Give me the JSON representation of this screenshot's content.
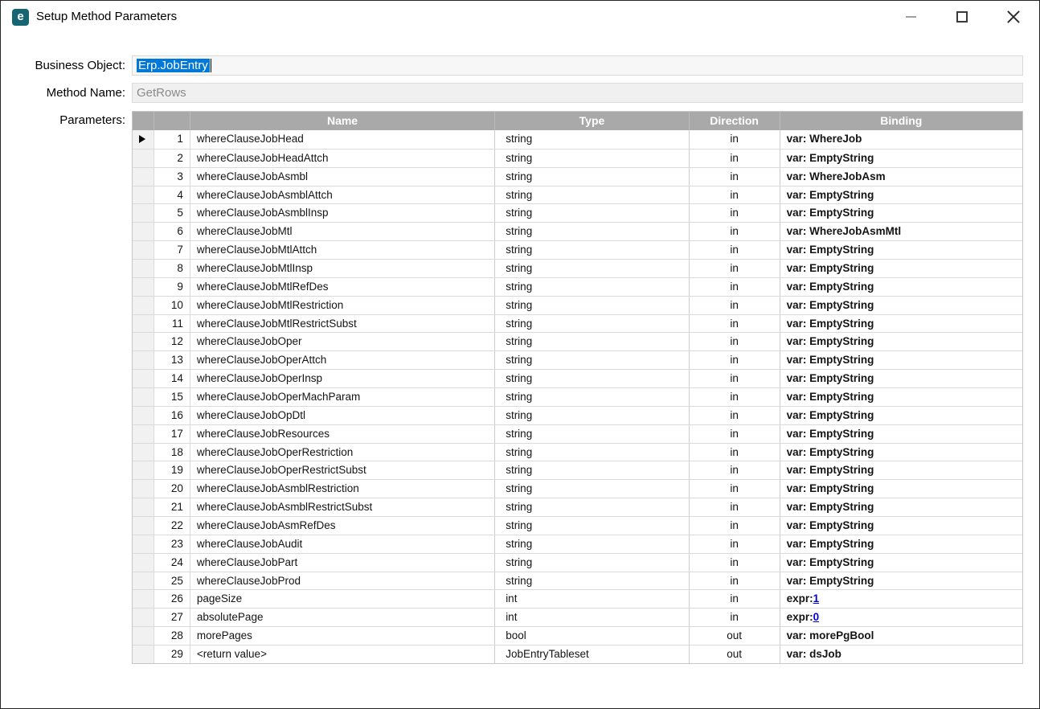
{
  "window": {
    "title": "Setup Method Parameters",
    "app_icon_glyph": "e",
    "controls": [
      {
        "name": "minimize"
      },
      {
        "name": "maximize"
      },
      {
        "name": "close"
      }
    ]
  },
  "form": {
    "business_object": {
      "label": "Business Object:",
      "value": "Erp.JobEntry",
      "selected": true
    },
    "method_name": {
      "label": "Method Name:",
      "value": "GetRows",
      "disabled": true
    },
    "parameters_label": "Parameters:"
  },
  "grid": {
    "columns": [
      "Name",
      "Type",
      "Direction",
      "Binding"
    ],
    "selected_row_index": 0,
    "rows": [
      {
        "num": "1",
        "name": "whereClauseJobHead",
        "type": "string",
        "direction": "in",
        "binding": "var: WhereJob"
      },
      {
        "num": "2",
        "name": "whereClauseJobHeadAttch",
        "type": "string",
        "direction": "in",
        "binding": "var: EmptyString"
      },
      {
        "num": "3",
        "name": "whereClauseJobAsmbl",
        "type": "string",
        "direction": "in",
        "binding": "var: WhereJobAsm"
      },
      {
        "num": "4",
        "name": "whereClauseJobAsmblAttch",
        "type": "string",
        "direction": "in",
        "binding": "var: EmptyString"
      },
      {
        "num": "5",
        "name": "whereClauseJobAsmblInsp",
        "type": "string",
        "direction": "in",
        "binding": "var: EmptyString"
      },
      {
        "num": "6",
        "name": "whereClauseJobMtl",
        "type": "string",
        "direction": "in",
        "binding": "var: WhereJobAsmMtl"
      },
      {
        "num": "7",
        "name": "whereClauseJobMtlAttch",
        "type": "string",
        "direction": "in",
        "binding": "var: EmptyString"
      },
      {
        "num": "8",
        "name": "whereClauseJobMtlInsp",
        "type": "string",
        "direction": "in",
        "binding": "var: EmptyString"
      },
      {
        "num": "9",
        "name": "whereClauseJobMtlRefDes",
        "type": "string",
        "direction": "in",
        "binding": "var: EmptyString"
      },
      {
        "num": "10",
        "name": "whereClauseJobMtlRestriction",
        "type": "string",
        "direction": "in",
        "binding": "var: EmptyString"
      },
      {
        "num": "11",
        "name": "whereClauseJobMtlRestrictSubst",
        "type": "string",
        "direction": "in",
        "binding": "var: EmptyString"
      },
      {
        "num": "12",
        "name": "whereClauseJobOper",
        "type": "string",
        "direction": "in",
        "binding": "var: EmptyString"
      },
      {
        "num": "13",
        "name": "whereClauseJobOperAttch",
        "type": "string",
        "direction": "in",
        "binding": "var: EmptyString"
      },
      {
        "num": "14",
        "name": "whereClauseJobOperInsp",
        "type": "string",
        "direction": "in",
        "binding": "var: EmptyString"
      },
      {
        "num": "15",
        "name": "whereClauseJobOperMachParam",
        "type": "string",
        "direction": "in",
        "binding": "var: EmptyString"
      },
      {
        "num": "16",
        "name": "whereClauseJobOpDtl",
        "type": "string",
        "direction": "in",
        "binding": "var: EmptyString"
      },
      {
        "num": "17",
        "name": "whereClauseJobResources",
        "type": "string",
        "direction": "in",
        "binding": "var: EmptyString"
      },
      {
        "num": "18",
        "name": "whereClauseJobOperRestriction",
        "type": "string",
        "direction": "in",
        "binding": "var: EmptyString"
      },
      {
        "num": "19",
        "name": "whereClauseJobOperRestrictSubst",
        "type": "string",
        "direction": "in",
        "binding": "var: EmptyString"
      },
      {
        "num": "20",
        "name": "whereClauseJobAsmblRestriction",
        "type": "string",
        "direction": "in",
        "binding": "var: EmptyString"
      },
      {
        "num": "21",
        "name": "whereClauseJobAsmblRestrictSubst",
        "type": "string",
        "direction": "in",
        "binding": "var: EmptyString"
      },
      {
        "num": "22",
        "name": "whereClauseJobAsmRefDes",
        "type": "string",
        "direction": "in",
        "binding": "var: EmptyString"
      },
      {
        "num": "23",
        "name": "whereClauseJobAudit",
        "type": "string",
        "direction": "in",
        "binding": "var: EmptyString"
      },
      {
        "num": "24",
        "name": "whereClauseJobPart",
        "type": "string",
        "direction": "in",
        "binding": "var: EmptyString"
      },
      {
        "num": "25",
        "name": "whereClauseJobProd",
        "type": "string",
        "direction": "in",
        "binding": "var: EmptyString"
      },
      {
        "num": "26",
        "name": "pageSize",
        "type": "int",
        "direction": "in",
        "binding": "expr:",
        "binding_link": "1"
      },
      {
        "num": "27",
        "name": "absolutePage",
        "type": "int",
        "direction": "in",
        "binding": "expr:",
        "binding_link": "0"
      },
      {
        "num": "28",
        "name": "morePages",
        "type": "bool",
        "direction": "out",
        "binding": "var: morePgBool"
      },
      {
        "num": "29",
        "name": "<return value>",
        "type": "JobEntryTableset",
        "direction": "out",
        "binding": "var: dsJob"
      }
    ]
  },
  "colors": {
    "accent_selection": "#0078d7",
    "app_icon_teal": "#156672",
    "grid_header_bg": "#a9a9a9",
    "link_blue": "#0000e0"
  }
}
